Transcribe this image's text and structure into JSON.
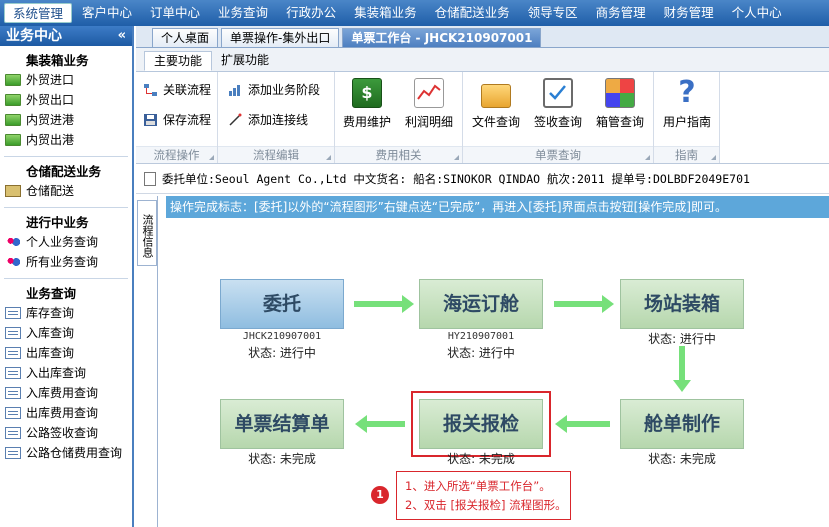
{
  "topnav": [
    "系统管理",
    "客户中心",
    "订单中心",
    "业务查询",
    "行政办公",
    "集装箱业务",
    "仓储配送业务",
    "领导专区",
    "商务管理",
    "财务管理",
    "个人中心"
  ],
  "sidebar": {
    "title": "业务中心",
    "collapse_icon": "«",
    "groups": [
      {
        "title": "集装箱业务",
        "items": [
          "外贸进口",
          "外贸出口",
          "内贸进港",
          "内贸出港"
        ]
      },
      {
        "title": "仓储配送业务",
        "items": [
          "仓储配送"
        ]
      },
      {
        "title": "进行中业务",
        "items": [
          "个人业务查询",
          "所有业务查询"
        ]
      },
      {
        "title": "业务查询",
        "items": [
          "库存查询",
          "入库查询",
          "出库查询",
          "入出库查询",
          "入库费用查询",
          "出库费用查询",
          "公路签收查询",
          "公路仓储费用查询"
        ]
      }
    ]
  },
  "tabs": [
    "个人桌面",
    "单票操作-集外出口",
    "单票工作台 - JHCK210907001"
  ],
  "ribbon": {
    "tabs": [
      "主要功能",
      "扩展功能"
    ],
    "groups": {
      "flow_ops": {
        "label": "流程操作",
        "buttons": [
          "关联流程",
          "保存流程"
        ]
      },
      "flow_edit": {
        "label": "流程编辑",
        "buttons": [
          "添加业务阶段",
          "添加连接线"
        ]
      },
      "fee": {
        "label": "费用相关",
        "buttons": [
          "费用维护",
          "利润明细"
        ]
      },
      "ticket": {
        "label": "单票查询",
        "buttons": [
          "文件查询",
          "签收查询",
          "箱管查询"
        ]
      },
      "guide": {
        "label": "指南",
        "buttons": [
          "用户指南"
        ]
      }
    }
  },
  "info": "委托单位:Seoul Agent Co.,Ltd  中文货名:  船名:SINOKOR QINDAO  航次:2011  提单号:DOLBDF2049E701",
  "vertical_tab": "流程信息",
  "notice": "操作完成标志：[委托]以外的“流程图形”右键点选“已完成”，再进入[委托]界面点击按钮[操作完成]即可。",
  "flow": {
    "nodes": {
      "n1": {
        "title": "委托",
        "code": "JHCK210907001",
        "status": "状态: 进行中"
      },
      "n2": {
        "title": "海运订舱",
        "code": "HY210907001",
        "status": "状态: 进行中"
      },
      "n3": {
        "title": "场站装箱",
        "status": "状态: 进行中"
      },
      "n4": {
        "title": "舱单制作",
        "status": "状态: 未完成"
      },
      "n5": {
        "title": "报关报检",
        "status": "状态: 未完成"
      },
      "n6": {
        "title": "单票结算单",
        "status": "状态: 未完成"
      }
    }
  },
  "callout": {
    "badge": "1",
    "line1": "1、进入所选“单票工作台”。",
    "line2": "2、双击 [报关报检] 流程图形。"
  },
  "colors": {
    "accent": "#1f5ea8",
    "node_green": "#b6d7ad",
    "node_blue": "#8fbde0",
    "arrow": "#76e07a",
    "highlight": "#d9262c"
  }
}
